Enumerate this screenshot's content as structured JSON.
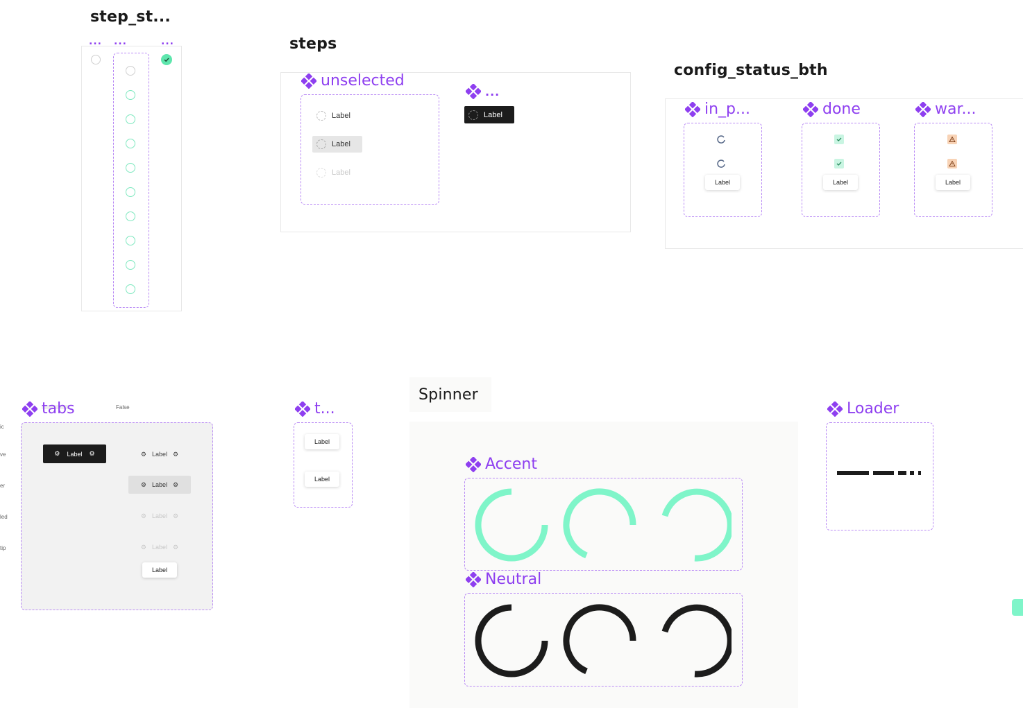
{
  "step_status": {
    "title": "step_st...",
    "column_labels": [
      "...",
      "...",
      "..."
    ]
  },
  "steps": {
    "title": "steps",
    "unselected": {
      "title": "unselected",
      "items": [
        "Label",
        "Label",
        "Label"
      ]
    },
    "selected": {
      "title": "...",
      "item": "Label"
    }
  },
  "config": {
    "title": "config_status_bth",
    "variants": [
      {
        "title": "in_p...",
        "label": "Label",
        "icon": "spinner-icon"
      },
      {
        "title": "done",
        "label": "Label",
        "icon": "check-icon"
      },
      {
        "title": "war...",
        "label": "Label",
        "icon": "warning-icon"
      }
    ]
  },
  "tabs": {
    "title": "tabs",
    "header_value": "False",
    "row_labels": [
      "ic",
      "ve",
      "er",
      "led",
      "tip"
    ],
    "active_tab": "Label",
    "tabs": [
      "Label",
      "Label",
      "Label",
      "Label"
    ],
    "tooltip": "Label"
  },
  "tooltip_comp": {
    "title": "t...",
    "items": [
      "Label",
      "Label"
    ]
  },
  "spinner": {
    "title": "Spinner",
    "accent": "Accent",
    "neutral": "Neutral"
  },
  "loader": {
    "title": "Loader"
  },
  "colors": {
    "accent": "#7ff5c9",
    "neutral": "#1c1c1c",
    "purple": "#8e3ff0",
    "warning": "#f5c9a6"
  }
}
